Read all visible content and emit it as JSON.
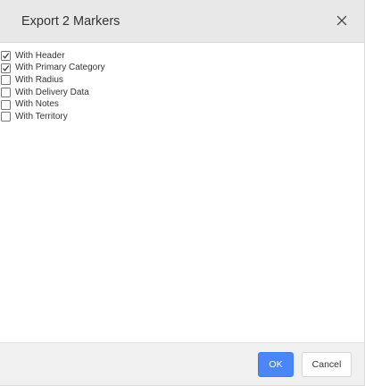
{
  "dialog": {
    "title": "Export 2 Markers",
    "close_icon": "close-icon",
    "options": [
      {
        "label": "With Header",
        "checked": true
      },
      {
        "label": "With Primary Category",
        "checked": true
      },
      {
        "label": "With Radius",
        "checked": false
      },
      {
        "label": "With Delivery Data",
        "checked": false
      },
      {
        "label": "With Notes",
        "checked": false
      },
      {
        "label": "With Territory",
        "checked": false
      }
    ],
    "ok_label": "OK",
    "cancel_label": "Cancel"
  },
  "colors": {
    "header_bg": "#e8e8e8",
    "footer_bg": "#f0f0f0",
    "primary_button": "#4a86f5"
  }
}
